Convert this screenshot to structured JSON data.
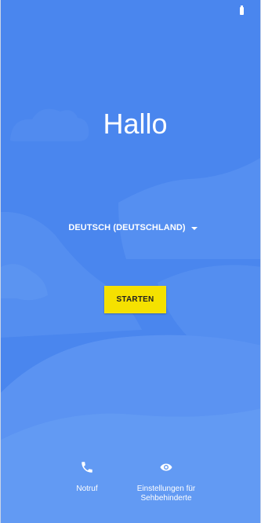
{
  "welcome": {
    "title": "Hallo",
    "language": "DEUTSCH (DEUTSCHLAND)",
    "start_button": "STARTEN"
  },
  "bottom_actions": {
    "emergency_label": "Notruf",
    "accessibility_line1": "Einstellungen für",
    "accessibility_line2": "Sehbehinderte"
  },
  "icons": {
    "battery": "battery-icon",
    "dropdown": "dropdown-arrow-icon",
    "phone": "phone-icon",
    "eye": "eye-icon"
  },
  "colors": {
    "background": "#4a86ee",
    "accent_button": "#f5e100",
    "text": "#ffffff"
  }
}
